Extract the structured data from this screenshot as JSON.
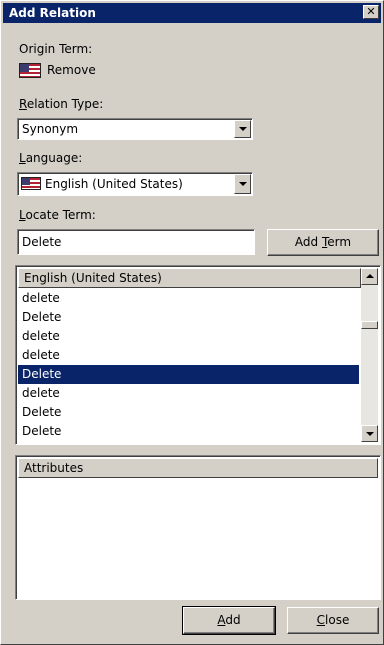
{
  "window": {
    "title": "Add Relation",
    "close_glyph": "✕"
  },
  "origin": {
    "label": "Origin Term:",
    "term": "Remove",
    "flag_icon": "us-flag-icon"
  },
  "relation_type": {
    "label_accel": "R",
    "label_rest": "elation Type:",
    "value": "Synonym"
  },
  "language": {
    "label_accel": "L",
    "label_rest": "anguage:",
    "value": "English (United States)",
    "flag_icon": "us-flag-icon"
  },
  "locate_term": {
    "label_accel": "L",
    "label_rest": "ocate Term:",
    "value": "Delete"
  },
  "add_term_button": {
    "label_pre": "Add ",
    "label_accel": "T",
    "label_post": "erm"
  },
  "terms_list": {
    "column_header": "English (United States)",
    "rows": [
      "delete",
      "Delete",
      "delete",
      "delete",
      "Delete",
      "delete",
      "Delete",
      "Delete"
    ],
    "selected_index": 4
  },
  "attributes": {
    "column_header": "Attributes"
  },
  "footer": {
    "add_accel": "A",
    "add_rest": "dd",
    "close_accel": "C",
    "close_rest": "lose"
  },
  "colors": {
    "face": "#d4d0c8",
    "title": "#0a246a",
    "selection": "#0a246a"
  }
}
